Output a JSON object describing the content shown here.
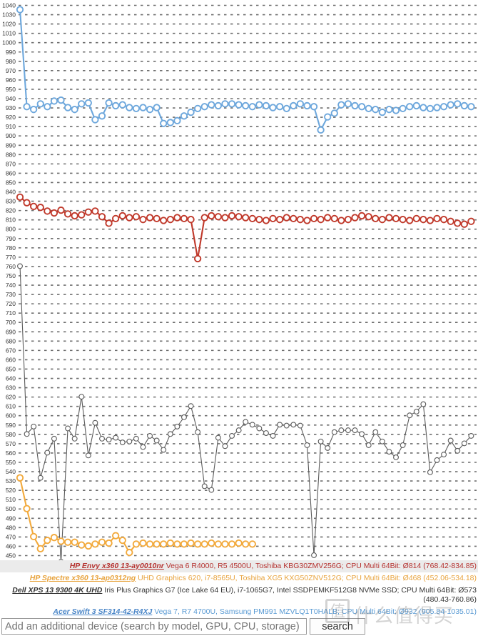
{
  "search": {
    "placeholder": "Add an additional device (search by model, GPU, CPU, storage)",
    "value": "",
    "button_label": "search"
  },
  "watermark": {
    "mark": "值",
    "text": "什么值得买"
  },
  "legend": [
    {
      "device": "HP Envy x360 13-ay0010nr",
      "details": " Vega 6 R4000, R5 4500U, Toshiba KBG30ZMV256G; CPU Multi 64Bit: Ø814 (768.42-834.85)",
      "color": "#b5322f",
      "highlight": true
    },
    {
      "device": "HP Spectre x360 13-ap0312ng",
      "details": " UHD Graphics 620, i7-8565U, Toshiba XG5 KXG50ZNV512G; CPU Multi 64Bit: Ø468 (452.06-534.18)",
      "color": "#e8a33d",
      "highlight": false
    },
    {
      "device": "Dell XPS 13 9300 4K UHD",
      "details": " Iris Plus Graphics G7 (Ice Lake 64 EU), i7-1065G7, Intel SSDPEMKF512G8 NVMe SSD; CPU Multi 64Bit: Ø573 (480.43-760.86)",
      "color": "#333333",
      "highlight": false
    },
    {
      "device": "Acer Swift 3 SF314-42-R4XJ",
      "details": " Vega 7, R7 4700U, Samsung PM991 MZVLQ1T0HALB; CPU Multi 64Bit: Ø932 (905.84-1035.01)",
      "color": "#4a86c8",
      "highlight": false
    }
  ],
  "chart_data": {
    "type": "line",
    "title": "",
    "xlabel": "",
    "ylabel": "",
    "ylim": [
      450,
      1040
    ],
    "ytick_step": 10,
    "ytick_labels": [
      1040,
      1030,
      1020,
      1010,
      1000,
      990,
      980,
      970,
      960,
      950,
      940,
      930,
      920,
      910,
      900,
      890,
      880,
      870,
      860,
      850,
      840,
      830,
      820,
      810,
      800,
      790,
      780,
      770,
      760,
      750,
      740,
      730,
      720,
      710,
      700,
      690,
      680,
      670,
      660,
      650,
      640,
      630,
      620,
      610,
      600,
      590,
      580,
      570,
      560,
      550,
      540,
      530,
      520,
      510,
      500,
      490,
      480,
      470,
      460,
      450
    ],
    "grid": true,
    "grid_style": "dashed",
    "legend_position": "bottom",
    "marker": "open-circle",
    "series": [
      {
        "name": "Acer Swift 3 SF314-42-R4XJ",
        "color": "#6da7dc",
        "values": [
          1035,
          931,
          928,
          934,
          931,
          937,
          938,
          930,
          928,
          934,
          935,
          917,
          921,
          935,
          932,
          933,
          930,
          929,
          930,
          928,
          930,
          913,
          914,
          916,
          921,
          925,
          929,
          931,
          933,
          932,
          934,
          934,
          933,
          932,
          931,
          933,
          932,
          930,
          931,
          929,
          932,
          934,
          932,
          931,
          906,
          920,
          924,
          933,
          934,
          932,
          931,
          929,
          928,
          925,
          928,
          927,
          929,
          931,
          932,
          930,
          929,
          930,
          931,
          933,
          934,
          932,
          931
        ]
      },
      {
        "name": "HP Envy x360 13-ay0010nr",
        "color": "#c0392b",
        "values": [
          834,
          828,
          824,
          823,
          819,
          817,
          820,
          816,
          814,
          815,
          818,
          819,
          813,
          806,
          811,
          814,
          812,
          813,
          810,
          812,
          811,
          809,
          810,
          812,
          811,
          810,
          768,
          812,
          814,
          813,
          812,
          814,
          813,
          812,
          811,
          810,
          809,
          811,
          810,
          812,
          811,
          810,
          809,
          811,
          810,
          812,
          811,
          809,
          810,
          812,
          814,
          813,
          811,
          810,
          812,
          811,
          810,
          809,
          811,
          810,
          809,
          811,
          810,
          808,
          806,
          805,
          808
        ]
      },
      {
        "name": "Dell XPS 13 9300 4K UHD",
        "color": "#5a5a5a",
        "values": [
          760,
          580,
          588,
          533,
          560,
          575,
          443,
          586,
          575,
          620,
          557,
          592,
          575,
          574,
          576,
          571,
          572,
          575,
          566,
          578,
          573,
          563,
          580,
          588,
          598,
          610,
          582,
          524,
          520,
          576,
          567,
          578,
          584,
          593,
          590,
          586,
          581,
          578,
          590,
          589,
          590,
          589,
          568,
          450,
          572,
          565,
          582,
          584,
          584,
          584,
          580,
          568,
          582,
          572,
          561,
          555,
          568,
          600,
          604,
          612,
          539,
          552,
          558,
          573,
          562,
          570,
          578
        ]
      },
      {
        "name": "HP Spectre x360 13-ap0312ng",
        "color": "#f2a93b",
        "values": [
          533,
          500,
          470,
          457,
          466,
          469,
          465,
          464,
          464,
          461,
          460,
          462,
          464,
          463,
          471,
          466,
          453,
          462,
          463,
          462,
          462,
          462,
          463,
          462,
          462,
          463,
          462,
          462,
          463,
          462,
          462,
          462,
          463,
          462,
          462
        ]
      }
    ]
  }
}
